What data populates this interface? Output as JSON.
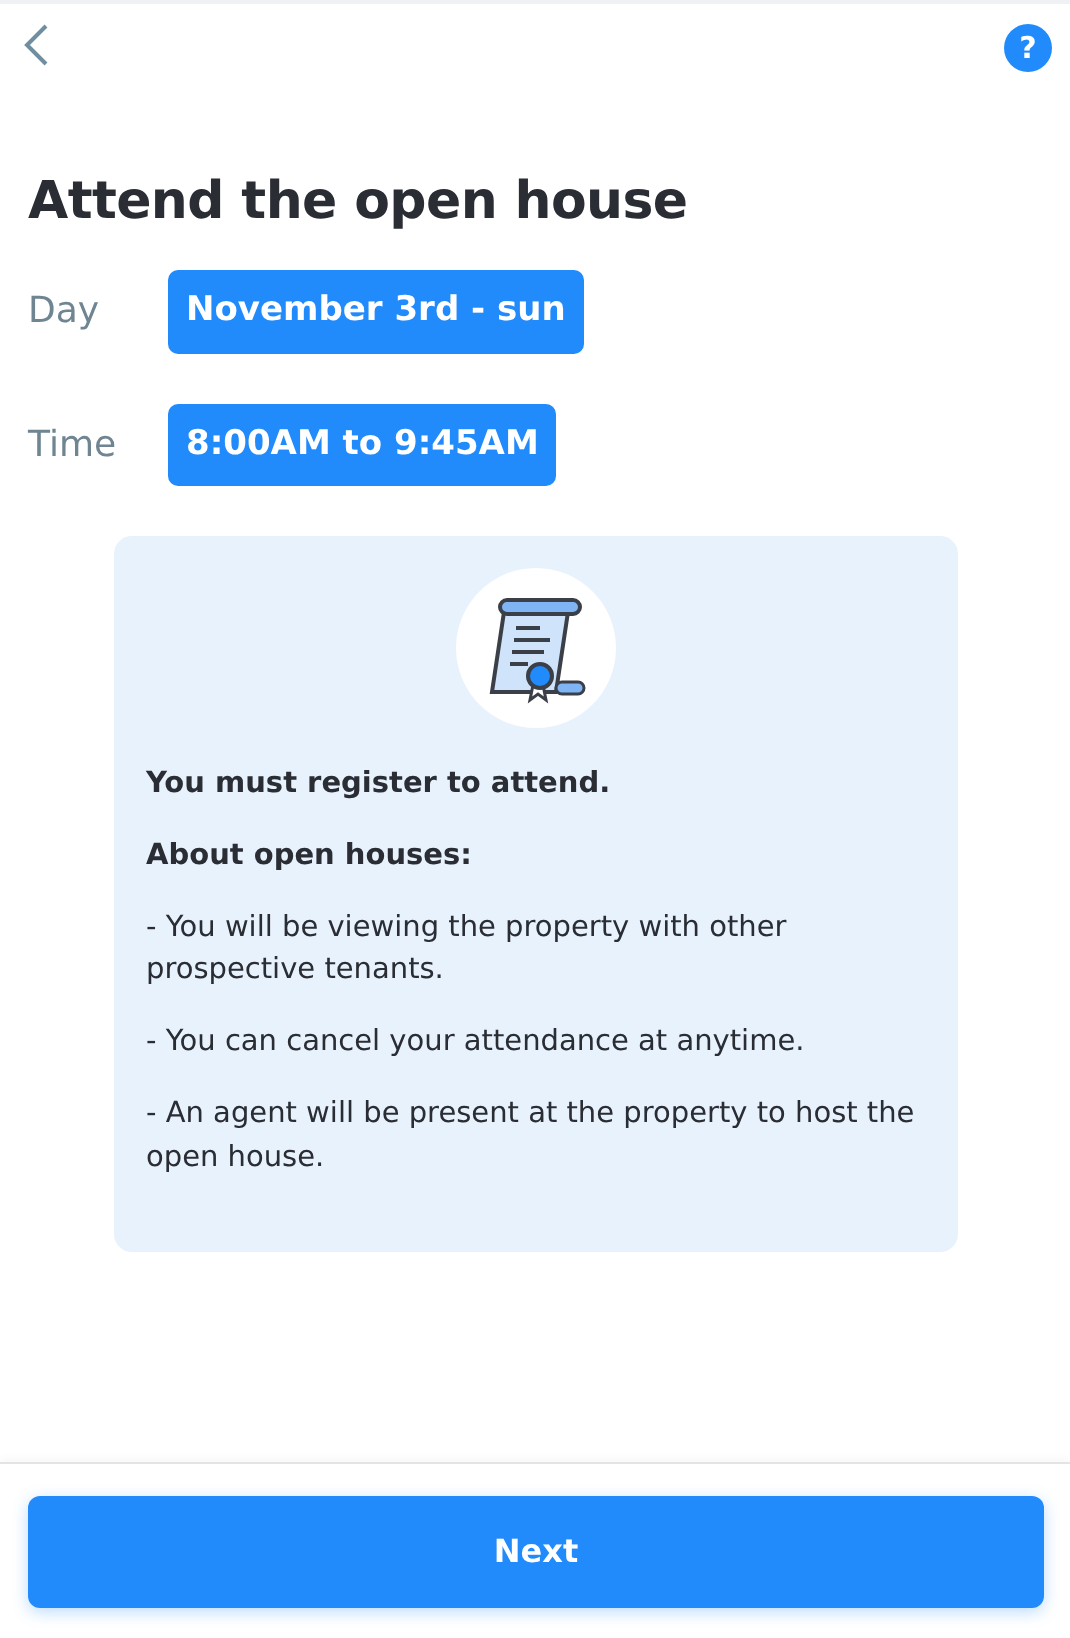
{
  "title": "Attend the open house",
  "details": [
    {
      "label": "Day",
      "value": "November 3rd - sun"
    },
    {
      "label": "Time",
      "value": "8:00AM to 9:45AM"
    }
  ],
  "info": [
    {
      "kind": "bold",
      "text": "You must register to attend."
    },
    {
      "kind": "bold",
      "text": "About open houses:"
    },
    {
      "kind": "plain",
      "text": "- You will be viewing the property with other prospective tenants."
    },
    {
      "kind": "plain",
      "text": "- You can cancel your attendance at anytime."
    },
    {
      "kind": "plain",
      "text": "- An agent will be present at the property to host the open house."
    }
  ],
  "help": {
    "label": "?"
  },
  "button": {
    "label": "Next"
  }
}
